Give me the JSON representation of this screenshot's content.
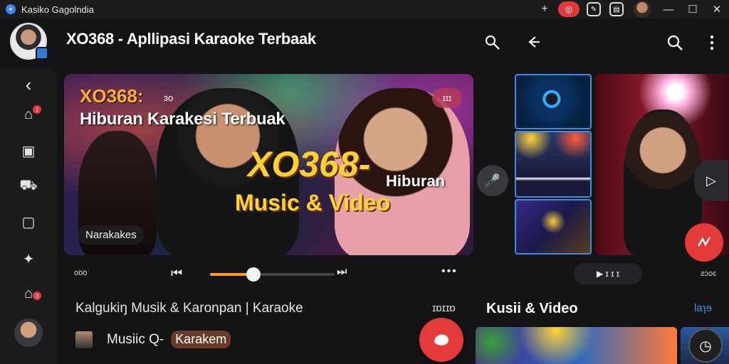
{
  "window": {
    "title": "Kasiko Gagolndia",
    "add_icon": "plus-icon",
    "minimize_label": "—",
    "maximize_label": "☐",
    "close_label": "✕"
  },
  "header": {
    "title": "XO368 - Apllipasi Karaoke Terbaak",
    "icons": [
      "mic-search-icon",
      "back-arrow-icon",
      "search-icon",
      "more-vertical-icon"
    ]
  },
  "sidebar": {
    "items": [
      {
        "icon": "back-chevron-icon",
        "glyph": "‹"
      },
      {
        "icon": "home-icon",
        "glyph": "⌂",
        "badge": "1"
      },
      {
        "icon": "wallet-icon",
        "glyph": "▣"
      },
      {
        "icon": "cart-icon",
        "glyph": "⛟"
      },
      {
        "icon": "screen-icon",
        "glyph": "▢"
      },
      {
        "icon": "bug-icon",
        "glyph": "✦"
      },
      {
        "icon": "home-badge-icon",
        "glyph": "⌂",
        "badge": "3"
      }
    ]
  },
  "hero": {
    "brand": "XO368:",
    "brand_suffix": "ɜo",
    "subtitle": "Hiburan Karakesi Terbuak",
    "big_title": "XO368-",
    "big_suffix": "Hiburan",
    "tagline": "Music & Video",
    "chip": "Narakakes",
    "more_label": "ɪɪɪ"
  },
  "player": {
    "time": "o͘o͘o͘",
    "prev_icon": "skip-previous-icon",
    "next_icon": "skip-next-icon",
    "progress": 0.35,
    "more_label": "•••"
  },
  "section": {
    "line": "Kalgukiŋ Musik & Karonpan  |  Karaoke",
    "right_label": "ɪɒɪɪɒ",
    "row_text": "Musiic Q-",
    "row_chip": "Karakem"
  },
  "right_panel": {
    "controls_label": "▶  ɪ  ɪ  ɪ",
    "right_text": "ƨɔoɛ",
    "section_title": "Kusii & Video",
    "section_link": "Ɩaɿɘ"
  },
  "colors": {
    "accent_red": "#e43a3a",
    "accent_orange": "#ff9a1a",
    "accent_blue": "#3f8ce0"
  }
}
